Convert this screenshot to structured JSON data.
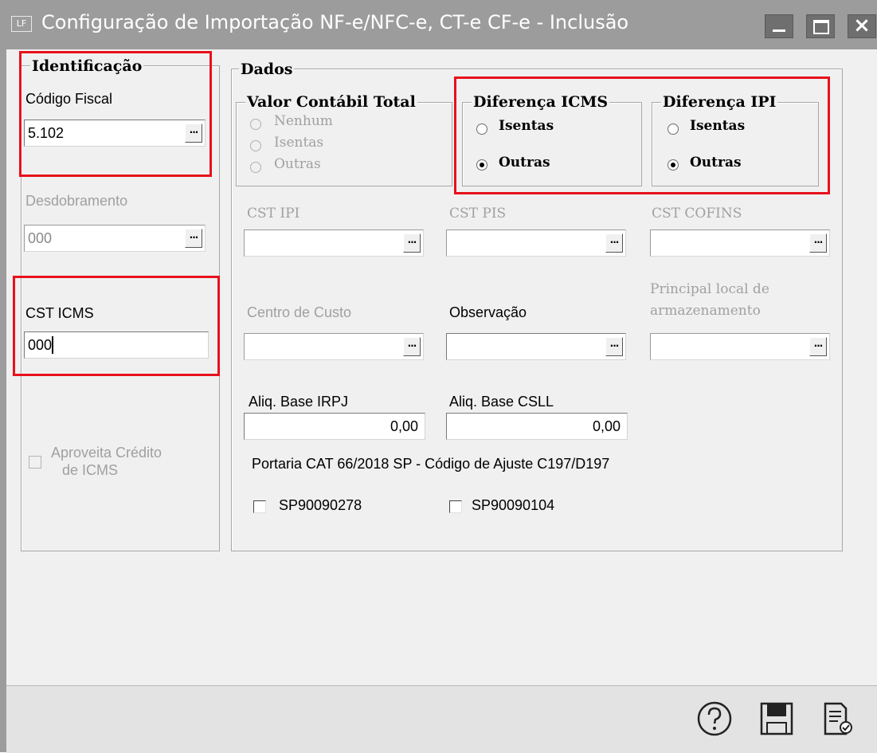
{
  "window": {
    "title": "Configuração de Importação NF-e/NFC-e, CT-e CF-e - Inclusão",
    "logo_text": "LF"
  },
  "identificacao": {
    "legend": "Identificação",
    "codigo_fiscal_label": "Código Fiscal",
    "codigo_fiscal_value": "5.102",
    "desdobramento_label": "Desdobramento",
    "desdobramento_value": "000",
    "cst_icms_label": "CST ICMS",
    "cst_icms_value": "000",
    "aproveita_line1": "Aproveita Crédito",
    "aproveita_line2": "de ICMS"
  },
  "dados": {
    "legend": "Dados",
    "valor_contabil": {
      "legend": "Valor Contábil Total",
      "options": [
        "Nenhum",
        "Isentas",
        "Outras"
      ]
    },
    "diferenca_icms": {
      "legend": "Diferença ICMS",
      "options": [
        "Isentas",
        "Outras"
      ],
      "selected": "Outras"
    },
    "diferenca_ipi": {
      "legend": "Diferença IPI",
      "options": [
        "Isentas",
        "Outras"
      ],
      "selected": "Outras"
    },
    "cst_ipi_label": "CST IPI",
    "cst_pis_label": "CST PIS",
    "cst_cofins_label": "CST COFINS",
    "centro_custo_label": "Centro de Custo",
    "observacao_label": "Observação",
    "principal_line1": "Principal local de",
    "principal_line2": "armazenamento",
    "aliq_irpj_label": "Aliq. Base IRPJ",
    "aliq_irpj_value": "0,00",
    "aliq_csll_label": "Aliq. Base CSLL",
    "aliq_csll_value": "0,00",
    "portaria_text": "Portaria CAT 66/2018 SP - Código de Ajuste C197/D197",
    "check1_label": "SP90090278",
    "check2_label": "SP90090104"
  },
  "toolbar": {
    "ellipsis": "..."
  },
  "colors": {
    "highlight": "#e8111c",
    "titlebar": "#9c9c9c",
    "window_bg": "#f0f0f0"
  },
  "icons": [
    "help-icon",
    "save-icon",
    "notes-icon"
  ]
}
